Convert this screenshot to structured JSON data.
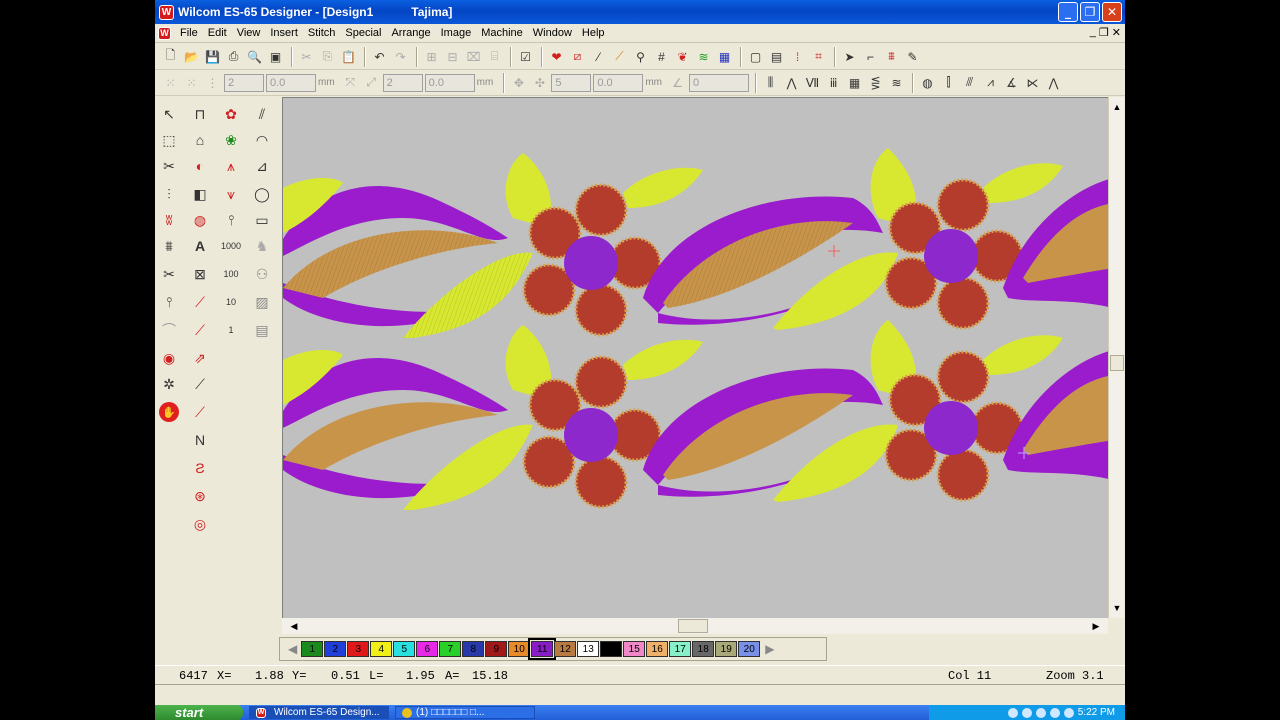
{
  "app": {
    "title": "Wilcom ES-65 Designer - [Design1",
    "title_tail": "Tajima]",
    "icon": "wilcom-logo-icon"
  },
  "menu": [
    "File",
    "Edit",
    "View",
    "Insert",
    "Stitch",
    "Special",
    "Arrange",
    "Image",
    "Machine",
    "Window",
    "Help"
  ],
  "toolbar2": {
    "fields": [
      {
        "value": "2",
        "unit": ""
      },
      {
        "value": "0.0",
        "unit": "mm"
      },
      {
        "value": "2",
        "unit": ""
      },
      {
        "value": "0.0",
        "unit": "mm"
      },
      {
        "value": "5",
        "unit": ""
      },
      {
        "value": "0.0",
        "unit": "mm"
      },
      {
        "value": "0",
        "unit": ""
      }
    ]
  },
  "colors": {
    "fabric": "#c0c0c0",
    "purple": "#9a1ccc",
    "gold": "#c8944a",
    "yellow": "#d8e830",
    "red": "#b43c2c",
    "violet": "#8c28cc"
  },
  "palette": [
    {
      "n": "1",
      "c": "#1a8a1a"
    },
    {
      "n": "2",
      "c": "#1f3fd8"
    },
    {
      "n": "3",
      "c": "#e01818"
    },
    {
      "n": "4",
      "c": "#f0f018"
    },
    {
      "n": "5",
      "c": "#28e0e0"
    },
    {
      "n": "6",
      "c": "#e828e8"
    },
    {
      "n": "7",
      "c": "#28d028"
    },
    {
      "n": "8",
      "c": "#2838a8"
    },
    {
      "n": "9",
      "c": "#a01818"
    },
    {
      "n": "10",
      "c": "#e88a28"
    },
    {
      "n": "11",
      "c": "#8a1cc8"
    },
    {
      "n": "12",
      "c": "#b87a40"
    },
    {
      "n": "13",
      "c": "#ffffff"
    },
    {
      "n": "",
      "c": "#000000"
    },
    {
      "n": "15",
      "c": "#f088c8"
    },
    {
      "n": "16",
      "c": "#f0b068"
    },
    {
      "n": "17",
      "c": "#88f0c8"
    },
    {
      "n": "18",
      "c": "#686868"
    },
    {
      "n": "19",
      "c": "#a8a878"
    },
    {
      "n": "20",
      "c": "#7890e8"
    }
  ],
  "palette_selected": "11",
  "status": {
    "stitches": "6417",
    "x_label": "X=",
    "x": "1.88",
    "y_label": "Y=",
    "y": "0.51",
    "l_label": "L=",
    "l": "1.95",
    "a_label": "A=",
    "a": "15.18",
    "col": "Col 11",
    "zoom": "Zoom 3.1"
  },
  "taskbar": {
    "start": "start",
    "tasks": [
      "Wilcom ES-65 Design...",
      "(1) □□□□□□ □..."
    ],
    "clock": "5:22 PM"
  }
}
